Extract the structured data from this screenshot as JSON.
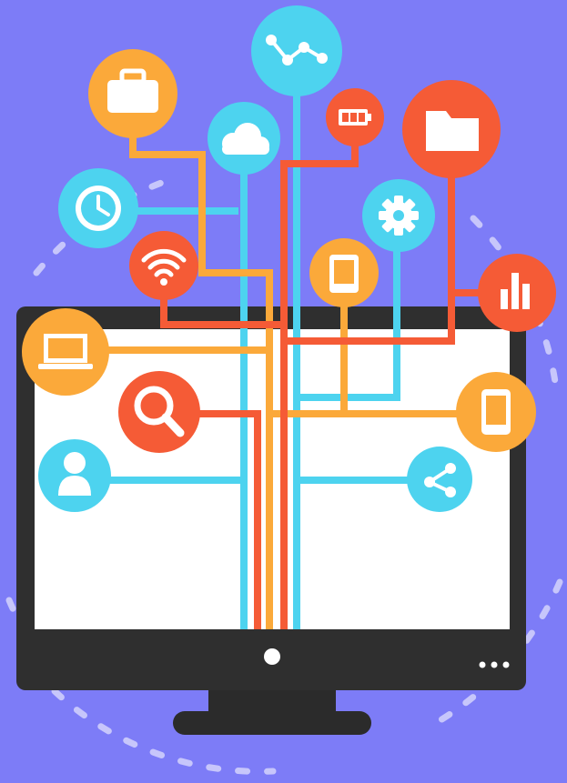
{
  "colors": {
    "background": "#7d7cf7",
    "cyan": "#4dd3ef",
    "orange": "#fba93a",
    "red": "#f55b36",
    "monitor": "#2f2f2f",
    "screen": "#ffffff",
    "dash": "#c7c6fb",
    "stand": "#2b2b2b"
  },
  "monitor": {
    "power_button": "power-button",
    "menu_dots": "menu-dots"
  },
  "icons": [
    {
      "name": "briefcase-icon",
      "color": "orange"
    },
    {
      "name": "chart-line-icon",
      "color": "cyan"
    },
    {
      "name": "battery-icon",
      "color": "red"
    },
    {
      "name": "folder-icon",
      "color": "red"
    },
    {
      "name": "cloud-icon",
      "color": "cyan"
    },
    {
      "name": "clock-icon",
      "color": "cyan"
    },
    {
      "name": "gear-icon",
      "color": "cyan"
    },
    {
      "name": "wifi-icon",
      "color": "red"
    },
    {
      "name": "tablet-icon",
      "color": "orange"
    },
    {
      "name": "bar-chart-icon",
      "color": "red"
    },
    {
      "name": "laptop-icon",
      "color": "orange"
    },
    {
      "name": "search-icon",
      "color": "red"
    },
    {
      "name": "mobile-phone-icon",
      "color": "orange"
    },
    {
      "name": "user-icon",
      "color": "cyan"
    },
    {
      "name": "share-icon",
      "color": "cyan"
    }
  ]
}
